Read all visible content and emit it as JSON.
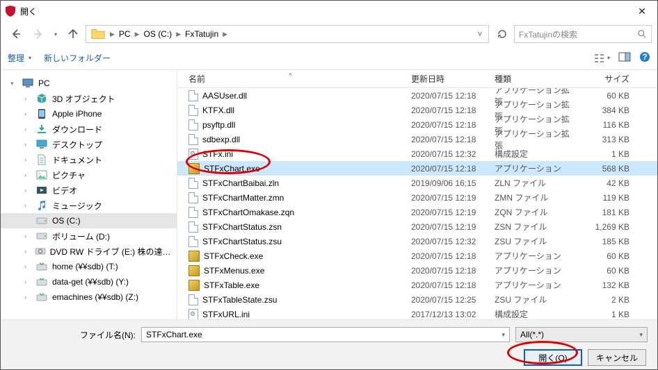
{
  "title": "開く",
  "breadcrumb": {
    "pc": "PC",
    "drive": "OS (C:)",
    "folder": "FxTatujin"
  },
  "search": {
    "placeholder": "FxTatujinの検索"
  },
  "toolbar": {
    "organize": "整理",
    "newfolder": "新しいフォルダー"
  },
  "columns": {
    "name": "名前",
    "date": "更新日時",
    "type": "種類",
    "size": "サイズ"
  },
  "sidebar": {
    "pc": "PC",
    "items": [
      {
        "label": "3D オブジェクト",
        "icon": "cube"
      },
      {
        "label": "Apple iPhone",
        "icon": "phone"
      },
      {
        "label": "ダウンロード",
        "icon": "download"
      },
      {
        "label": "デスクトップ",
        "icon": "desktop"
      },
      {
        "label": "ドキュメント",
        "icon": "doc"
      },
      {
        "label": "ピクチャ",
        "icon": "picture"
      },
      {
        "label": "ビデオ",
        "icon": "video"
      },
      {
        "label": "ミュージック",
        "icon": "music"
      },
      {
        "label": "OS (C:)",
        "icon": "drive",
        "selected": true
      },
      {
        "label": "ボリューム (D:)",
        "icon": "drive"
      },
      {
        "label": "DVD RW ドライブ (E:) 株の達人インス",
        "icon": "dvd"
      },
      {
        "label": "home (¥¥sdb) (T:)",
        "icon": "net"
      },
      {
        "label": "data-get (¥¥sdb) (Y:)",
        "icon": "net"
      },
      {
        "label": "emachines (¥¥sdb) (Z:)",
        "icon": "net"
      }
    ]
  },
  "files": [
    {
      "name": "AASUser.dll",
      "date": "2020/07/15 12:18",
      "type": "アプリケーション拡張",
      "size": "60 KB",
      "icon": "doc"
    },
    {
      "name": "KTFX.dll",
      "date": "2020/07/15 12:18",
      "type": "アプリケーション拡張",
      "size": "384 KB",
      "icon": "doc"
    },
    {
      "name": "psyftp.dll",
      "date": "2020/07/15 12:18",
      "type": "アプリケーション拡張",
      "size": "116 KB",
      "icon": "doc"
    },
    {
      "name": "sdbexp.dll",
      "date": "2020/07/15 12:18",
      "type": "アプリケーション拡張",
      "size": "313 KB",
      "icon": "doc"
    },
    {
      "name": "STFx.ini",
      "date": "2020/07/15 12:32",
      "type": "構成設定",
      "size": "1 KB",
      "icon": "ini"
    },
    {
      "name": "STFxChart.exe",
      "date": "2020/07/15 12:18",
      "type": "アプリケーション",
      "size": "568 KB",
      "icon": "exe-y",
      "selected": true
    },
    {
      "name": "STFxChartBaibai.zln",
      "date": "2019/09/06 16:15",
      "type": "ZLN ファイル",
      "size": "42 KB",
      "icon": "doc"
    },
    {
      "name": "STFxChartMatter.zmn",
      "date": "2020/07/15 12:19",
      "type": "ZMN ファイル",
      "size": "119 KB",
      "icon": "doc"
    },
    {
      "name": "STFxChartOmakase.zqn",
      "date": "2020/07/15 12:19",
      "type": "ZQN ファイル",
      "size": "181 KB",
      "icon": "doc"
    },
    {
      "name": "STFxChartStatus.zsn",
      "date": "2020/07/15 12:19",
      "type": "ZSN ファイル",
      "size": "1,269 KB",
      "icon": "doc"
    },
    {
      "name": "STFxChartStatus.zsu",
      "date": "2020/07/15 12:32",
      "type": "ZSU ファイル",
      "size": "185 KB",
      "icon": "doc"
    },
    {
      "name": "STFxCheck.exe",
      "date": "2020/07/15 12:18",
      "type": "アプリケーション",
      "size": "60 KB",
      "icon": "exe-y"
    },
    {
      "name": "STFxMenus.exe",
      "date": "2020/07/15 12:18",
      "type": "アプリケーション",
      "size": "60 KB",
      "icon": "exe-y"
    },
    {
      "name": "STFxTable.exe",
      "date": "2020/07/15 12:18",
      "type": "アプリケーション",
      "size": "132 KB",
      "icon": "exe-y"
    },
    {
      "name": "STFxTableState.zsu",
      "date": "2020/07/15 12:25",
      "type": "ZSU ファイル",
      "size": "2 KB",
      "icon": "doc"
    },
    {
      "name": "STFxURL.ini",
      "date": "2017/12/13 13:02",
      "type": "構成設定",
      "size": "1 KB",
      "icon": "ini"
    }
  ],
  "footer": {
    "fname_label": "ファイル名(N):",
    "fname_value": "STFxChart.exe",
    "filter": "All(*.*)",
    "open": "開く(O)",
    "cancel": "キャンセル"
  }
}
